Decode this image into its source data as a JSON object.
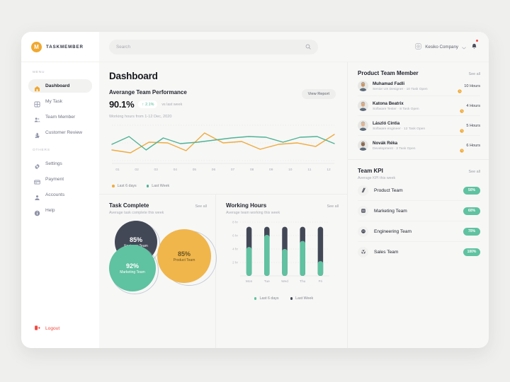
{
  "brand": {
    "logo_letter": "M",
    "name": "TASKMEMBER"
  },
  "sidebar": {
    "group1_label": "MENU",
    "group2_label": "OTHERS",
    "items1": [
      {
        "label": "Dashboard",
        "icon": "home-icon"
      },
      {
        "label": "My Task",
        "icon": "grid-icon"
      },
      {
        "label": "Team Member",
        "icon": "people-icon"
      },
      {
        "label": "Customer Review",
        "icon": "puzzle-icon"
      }
    ],
    "items2": [
      {
        "label": "Settings",
        "icon": "gear-icon"
      },
      {
        "label": "Payment",
        "icon": "card-icon"
      },
      {
        "label": "Accounts",
        "icon": "person-icon"
      },
      {
        "label": "Help",
        "icon": "info-icon"
      }
    ],
    "logout": {
      "label": "Logout",
      "icon": "logout-icon",
      "color": "#f0483f"
    }
  },
  "topbar": {
    "search_placeholder": "Search",
    "search_value": "",
    "company": "Kesiko Company",
    "company_icon": "company-badge-icon",
    "chevron": "⌄",
    "bell_icon": "bell-icon",
    "has_notification": true
  },
  "page": {
    "title": "Dashboard"
  },
  "performance": {
    "title": "Averange Team Performance",
    "value": "90.1%",
    "delta_arrow": "↑",
    "delta": "2.1%",
    "delta_note": "vs last week",
    "subtitle": "Working hours from 1-12 Dec, 2020",
    "view_report_label": "View Report"
  },
  "chart_data": [
    {
      "id": "performance-line",
      "type": "line",
      "title": "Averange Team Performance",
      "xlabel": "",
      "ylabel": "",
      "grid": true,
      "legend_position": "bottom-left",
      "x": [
        "01",
        "02",
        "03",
        "04",
        "05",
        "06",
        "07",
        "08",
        "09",
        "10",
        "11",
        "12"
      ],
      "ylim": [
        0,
        100
      ],
      "series": [
        {
          "name": "Last 6 days",
          "color": "#f0ab3d",
          "values": [
            30,
            22,
            52,
            50,
            28,
            78,
            50,
            54,
            32,
            46,
            50,
            40,
            74
          ]
        },
        {
          "name": "Last Week",
          "color": "#4fb395",
          "values": [
            46,
            68,
            30,
            64,
            48,
            52,
            58,
            64,
            68,
            66,
            52,
            66,
            68,
            48
          ]
        }
      ]
    },
    {
      "id": "task-complete-circles",
      "type": "pie",
      "title": "Task Complete",
      "subtitle": "Average task complete this week",
      "categories": [
        "Engineer Team",
        "Marketing Team",
        "Product Team"
      ],
      "values": [
        85,
        92,
        85
      ],
      "labels": [
        "85%",
        "92%",
        "85%"
      ],
      "colors": [
        "#434857",
        "#5fc2a0",
        "#f0b64c"
      ]
    },
    {
      "id": "working-hours-bars",
      "type": "bar",
      "title": "Working Hours",
      "subtitle": "Average team working this week",
      "categories": [
        "Mon",
        "Tue",
        "Wed",
        "Thu",
        "Fri"
      ],
      "xlabel": "",
      "ylabel": "",
      "ylim": [
        0,
        8
      ],
      "yticks": [
        "2 hr",
        "4 hr",
        "6 hr",
        "8 hr"
      ],
      "grid": true,
      "stacked": true,
      "legend_position": "bottom",
      "series": [
        {
          "name": "Last 6 days",
          "color": "#5fc2a0",
          "values": [
            4.3,
            6.1,
            4.0,
            5.2,
            2.2
          ]
        },
        {
          "name": "Last Week",
          "color": "#434857",
          "values": [
            3.0,
            1.2,
            3.3,
            2.1,
            5.1
          ]
        }
      ]
    }
  ],
  "members_panel": {
    "title": "Product Team Member",
    "see_all": "See all",
    "clock_icon": "clock-icon",
    "rows": [
      {
        "name": "Muhamad Fadli",
        "meta": "Senior UX Designer · 10 Task Open",
        "hours": "10 Hours",
        "avatar": "avatar-1"
      },
      {
        "name": "Katona Beatrix",
        "meta": "Software Tester · 8 Task Open",
        "hours": "4 Hours",
        "avatar": "avatar-2"
      },
      {
        "name": "László Cintia",
        "meta": "Software engineer · 12 Task Open",
        "hours": "5 Hours",
        "avatar": "avatar-3"
      },
      {
        "name": "Novák Réka",
        "meta": "Development · 3 Task Open",
        "hours": "6 Hours",
        "avatar": "avatar-4"
      }
    ]
  },
  "task_complete": {
    "title": "Task Complete",
    "see_all": "See all",
    "subtitle": "Average task complete this week",
    "circles": [
      {
        "pct": "85%",
        "name": "Engineer Team"
      },
      {
        "pct": "92%",
        "name": "Marketing Team"
      },
      {
        "pct": "85%",
        "name": "Product Team"
      }
    ]
  },
  "working_hours": {
    "title": "Working Hours",
    "see_all": "See all",
    "subtitle": "Average team working this week",
    "legend": [
      {
        "label": "Last 6 days",
        "color": "#5fc2a0"
      },
      {
        "label": "Last Week",
        "color": "#434857"
      }
    ]
  },
  "perf_legend": [
    {
      "label": "Last 6 days",
      "color": "#f0ab3d"
    },
    {
      "label": "Last Week",
      "color": "#4fb395"
    }
  ],
  "team_kpi": {
    "title": "Team KPI",
    "see_all": "See all",
    "subtitle": "Average KPI this week",
    "rows": [
      {
        "label": "Product Team",
        "value": "50%",
        "icon": "slash-icon"
      },
      {
        "label": "Marketing Team",
        "value": "60%",
        "icon": "megaphone-icon"
      },
      {
        "label": "Engineering Team",
        "value": "70%",
        "icon": "gear-dark-icon"
      },
      {
        "label": "Sales Team",
        "value": "100%",
        "icon": "atom-icon"
      }
    ]
  }
}
